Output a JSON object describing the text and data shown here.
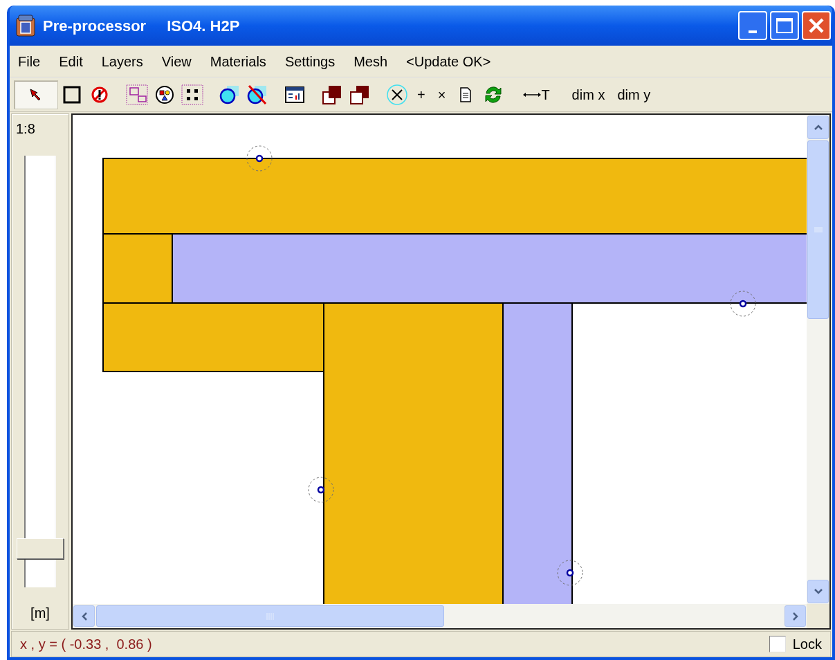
{
  "window": {
    "title": "Pre-processor",
    "file": "ISO4. H2P"
  },
  "menu": [
    {
      "label": "File"
    },
    {
      "label": "Edit"
    },
    {
      "label": "Layers"
    },
    {
      "label": "View"
    },
    {
      "label": "Materials"
    },
    {
      "label": "Settings"
    },
    {
      "label": "Mesh"
    },
    {
      "label": "<Update OK>"
    }
  ],
  "toolbar": [
    [
      {
        "kind": "pointer",
        "selected": true
      },
      {
        "kind": "square",
        "selected": false
      },
      {
        "kind": "forbidden",
        "selected": false
      }
    ],
    [
      {
        "kind": "regions",
        "selected": false
      },
      {
        "kind": "shapes",
        "selected": false
      },
      {
        "kind": "dots",
        "selected": false
      }
    ],
    [
      {
        "kind": "circle",
        "selected": false
      },
      {
        "kind": "circle-struck",
        "selected": false
      }
    ],
    [
      {
        "kind": "chart",
        "selected": false
      }
    ],
    [
      {
        "kind": "filled-squares",
        "selected": false
      },
      {
        "kind": "outline-squares",
        "selected": false
      }
    ],
    [
      {
        "kind": "x-circle",
        "selected": false
      },
      {
        "kind": "text",
        "label": "+",
        "selected": false
      },
      {
        "kind": "text",
        "label": "×",
        "selected": false
      },
      {
        "kind": "document",
        "selected": false
      },
      {
        "kind": "refresh",
        "selected": false
      }
    ],
    [
      {
        "kind": "dimension",
        "label": "T",
        "selected": false
      }
    ],
    [
      {
        "kind": "text",
        "label": "dim x",
        "selected": false
      },
      {
        "kind": "text",
        "label": "dim y",
        "selected": false
      }
    ]
  ],
  "scale_panel": {
    "scale": "1:8",
    "unit": "[m]",
    "zoom": {
      "level": 0.09
    }
  },
  "canvas": {
    "regions": [
      {
        "color": "#f0b90f"
      },
      {
        "color": "#f0b90f"
      },
      {
        "color": "#b4b4f8"
      },
      {
        "color": "#f0b90f"
      },
      {
        "color": "#f0b90f"
      },
      {
        "color": "#b4b4f8"
      }
    ]
  },
  "status_bar": {
    "coordinates": "x , y = ( -0.33 ,  0.86 )",
    "lock": {
      "label": "Lock",
      "checked": false
    }
  }
}
